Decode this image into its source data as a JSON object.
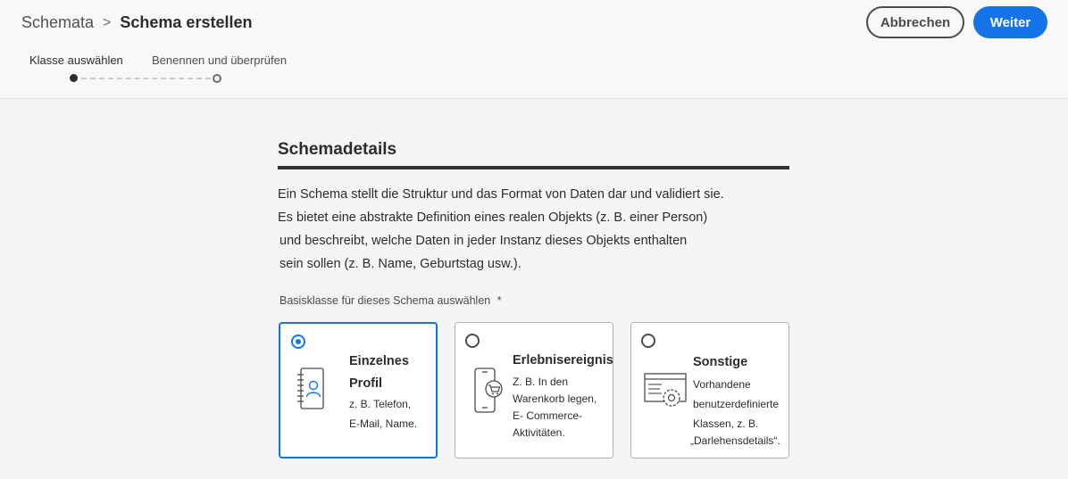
{
  "breadcrumb": {
    "root": "Schemata",
    "separator": ">",
    "current": "Schema erstellen"
  },
  "actions": {
    "cancel_label": "Abbrechen",
    "next_label": "Weiter"
  },
  "steps": [
    {
      "label": "Klasse auswählen",
      "state": "active"
    },
    {
      "label": "Benennen und überprüfen",
      "state": "pending"
    }
  ],
  "section": {
    "title": "Schemadetails",
    "description_lines": [
      "Ein Schema stellt die Struktur und das Format von Daten dar und validiert sie.",
      "Es bietet eine abstrakte Definition eines realen Objekts (z. B. einer Person)",
      "und beschreibt, welche Daten in jeder Instanz dieses Objekts enthalten",
      "sein sollen (z. B. Name, Geburtstag usw.)."
    ]
  },
  "class_select": {
    "label": "Basisklasse für dieses Schema auswählen",
    "required_marker": "*",
    "options": [
      {
        "title_lines": [
          "Einzelnes",
          "Profil"
        ],
        "desc_lines": [
          "z. B. Telefon,",
          "E-Mail, Name."
        ],
        "icon": "contact-book-icon",
        "selected": true
      },
      {
        "title_lines": [
          "Erlebnisereignis"
        ],
        "desc_lines": [
          "Z. B. In den",
          "Warenkorb legen,",
          "E- Commerce-",
          "Aktivitäten."
        ],
        "icon": "mobile-cart-icon",
        "selected": false
      },
      {
        "title_lines": [
          "Sonstige"
        ],
        "desc_lines": [
          "Vorhandene",
          "benutzerdefinierte",
          "Klassen, z. B.",
          "„Darlehensdetails“."
        ],
        "icon": "window-gear-icon",
        "selected": false
      }
    ]
  },
  "colors": {
    "accent": "#1473e6",
    "text": "#2c2c2c",
    "background": "#f5f5f5"
  }
}
